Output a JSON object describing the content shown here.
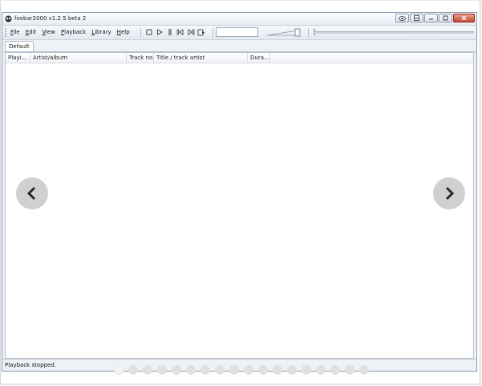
{
  "window": {
    "title": "foobar2000 v1.2.5 beta 2",
    "buttons": [
      "eye-icon",
      "layout-icon",
      "minimize-icon",
      "maximize-icon",
      "close-icon"
    ]
  },
  "menu": {
    "items": [
      {
        "label": "File",
        "accel": "F",
        "rest": "ile"
      },
      {
        "label": "Edit",
        "accel": "E",
        "rest": "dit"
      },
      {
        "label": "View",
        "accel": "V",
        "rest": "iew"
      },
      {
        "label": "Playback",
        "accel": "P",
        "rest": "layback"
      },
      {
        "label": "Library",
        "accel": "L",
        "rest": "ibrary"
      },
      {
        "label": "Help",
        "accel": "H",
        "rest": "elp"
      }
    ]
  },
  "toolbar": {
    "transport_icons": [
      "stop-icon",
      "play-icon",
      "pause-icon",
      "previous-icon",
      "next-icon",
      "random-icon"
    ],
    "search_value": ""
  },
  "tabs": [
    {
      "label": "Default"
    }
  ],
  "playlist": {
    "columns": [
      {
        "label": "Playi..."
      },
      {
        "label": "Artist/album"
      },
      {
        "label": "Track no"
      },
      {
        "label": "Title / track artist"
      },
      {
        "label": "Dura..."
      }
    ],
    "rows": []
  },
  "status": {
    "text": "Playback stopped."
  },
  "carousel": {
    "dot_count": 18,
    "active_index": 0
  },
  "colors": {
    "window_border": "#8a9bb0",
    "close_button": "#c7452e",
    "arrow_bg": "#c8c8c8"
  }
}
